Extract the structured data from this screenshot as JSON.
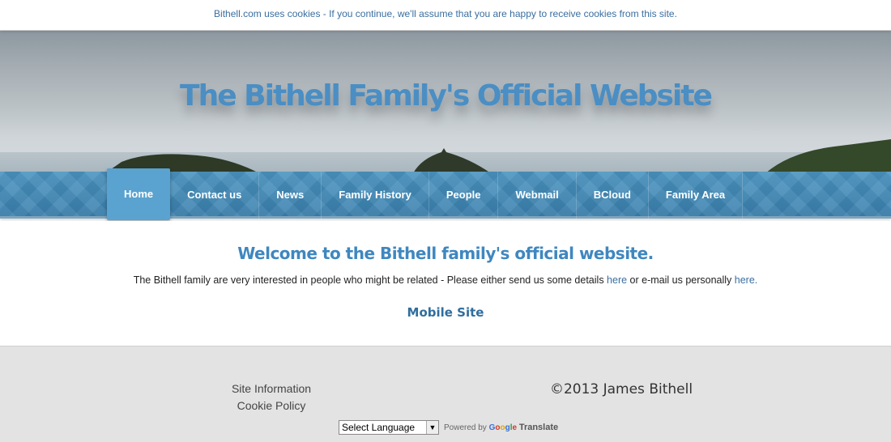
{
  "cookie_notice": "Bithell.com uses cookies - If you continue, we'll assume that you are happy to receive cookies from this site.",
  "site_title": "The Bithell Family's Official Website",
  "nav": {
    "active_index": 0,
    "items": [
      {
        "label": "Home"
      },
      {
        "label": "Contact us"
      },
      {
        "label": "News"
      },
      {
        "label": "Family History"
      },
      {
        "label": "People"
      },
      {
        "label": "Webmail"
      },
      {
        "label": "BCloud"
      },
      {
        "label": "Family Area"
      }
    ]
  },
  "main": {
    "heading": "Welcome to the Bithell family's official website.",
    "intro_part1": "The Bithell family are very interested in people who might be related - Please either send us some details ",
    "intro_link1": "here",
    "intro_part2": " or e-mail us personally ",
    "intro_link2": "here.",
    "mobile_link": "Mobile Site"
  },
  "footer": {
    "site_information": "Site Information",
    "cookie_policy": "Cookie Policy",
    "copyright": "©2013 James Bithell",
    "language_select": "Select Language",
    "powered_by": "Powered by",
    "google_letters": [
      "G",
      "o",
      "o",
      "g",
      "l",
      "e"
    ],
    "translate": "Translate"
  },
  "colors": {
    "title_blue": "#4a8ec4",
    "nav_blue": "#3a80ad",
    "link_blue": "#3a6ea0",
    "footer_bg": "#e3e3e3"
  }
}
